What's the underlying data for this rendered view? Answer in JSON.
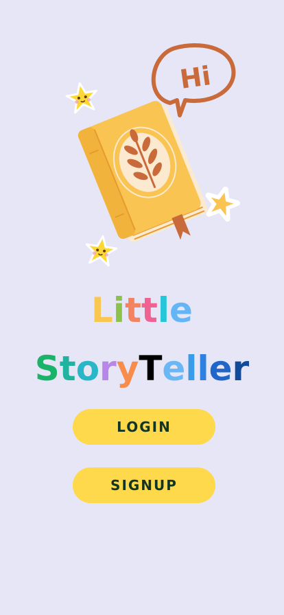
{
  "app": {
    "background": "#e6e6f7"
  },
  "hero": {
    "speech_bubble_text": "Hi",
    "icons": [
      "star-icon",
      "book-icon",
      "leaf-icon",
      "speech-bubble-icon"
    ],
    "colors": {
      "book": "#f9c451",
      "book_dark": "#e79b2f",
      "bubble": "#c96a3b",
      "star": "#fdd835"
    }
  },
  "title": {
    "line1": [
      {
        "char": "L",
        "color": "#f9c74f"
      },
      {
        "char": "i",
        "color": "#8bc34a"
      },
      {
        "char": "t",
        "color": "#f4845f"
      },
      {
        "char": "t",
        "color": "#f06292"
      },
      {
        "char": "l",
        "color": "#26c6da"
      },
      {
        "char": "e",
        "color": "#64b5f6"
      }
    ],
    "line2": [
      {
        "char": "S",
        "color": "#1bb36a"
      },
      {
        "char": "t",
        "color": "#20b4a0"
      },
      {
        "char": "o",
        "color": "#29b6c6"
      },
      {
        "char": "r",
        "color": "#b886e8"
      },
      {
        "char": "y",
        "color": "#f78c4b"
      },
      {
        "char": "T",
        "color": "#000000"
      },
      {
        "char": "e",
        "color": "#6ab7f5"
      },
      {
        "char": "l",
        "color": "#3a9be8"
      },
      {
        "char": "l",
        "color": "#2d7fe0"
      },
      {
        "char": "e",
        "color": "#1f66c8"
      },
      {
        "char": "r",
        "color": "#114a99"
      }
    ]
  },
  "buttons": {
    "login_label": "LOGIN",
    "signup_label": "SIGNUP",
    "background": "#fdd94b",
    "text_color": "#123524"
  }
}
